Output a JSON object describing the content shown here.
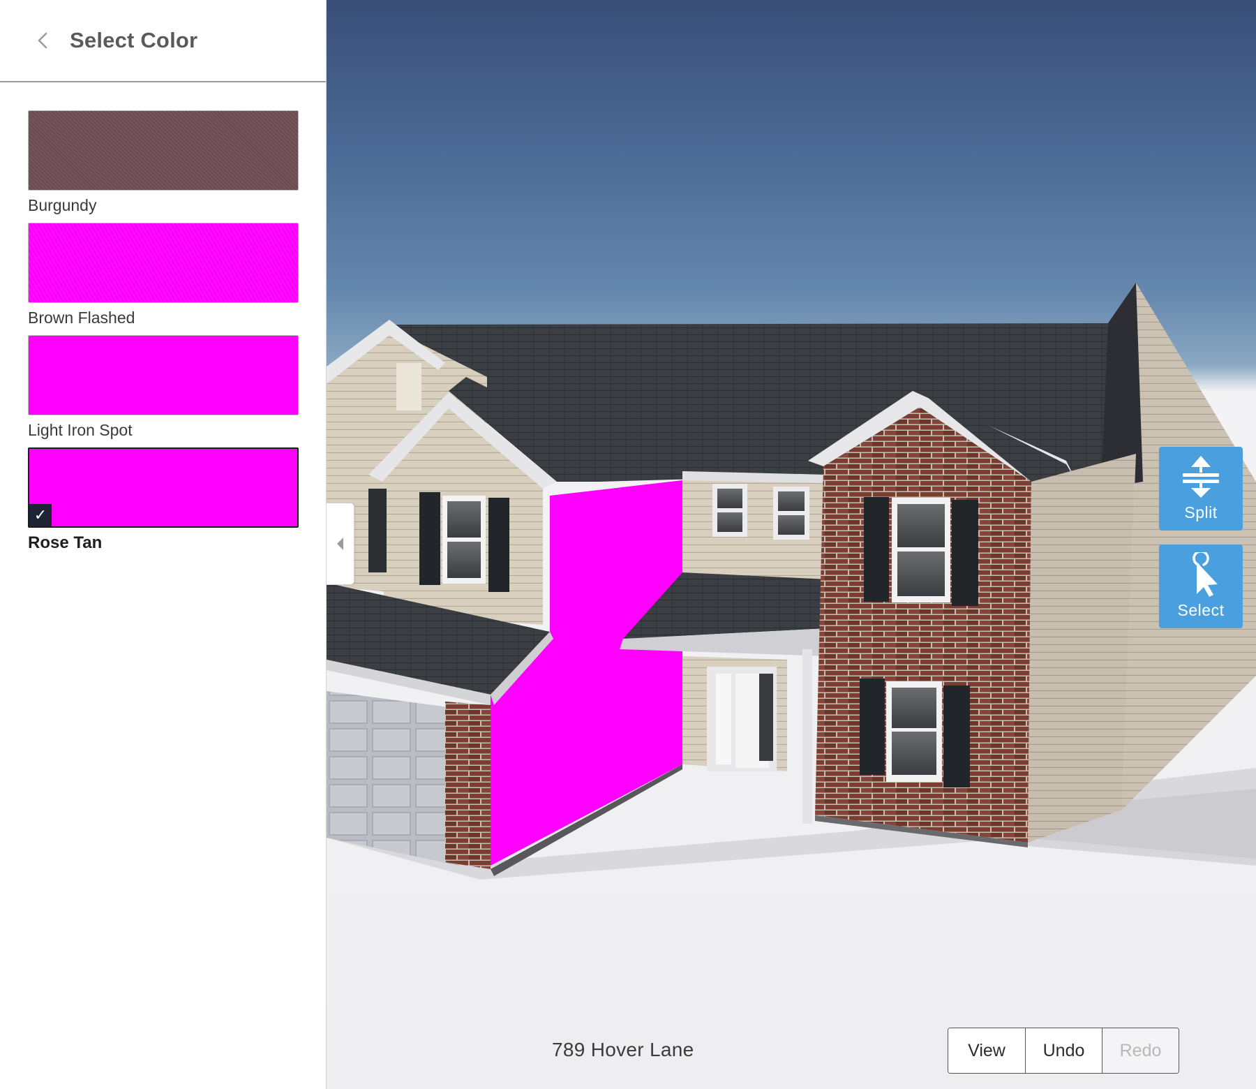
{
  "sidebar": {
    "title": "Select Color",
    "back_icon": "chevron-left-icon",
    "swatches": [
      {
        "label": "Burgundy",
        "color": "#6f4f55",
        "selected": false
      },
      {
        "label": "Brown Flashed",
        "color": "#ff00ff",
        "selected": false
      },
      {
        "label": "Light Iron Spot",
        "color": "#ff00ff",
        "selected": false
      },
      {
        "label": "Rose Tan",
        "color": "#ff00ff",
        "selected": true,
        "check_icon": "checkmark-icon",
        "check_glyph": "✓"
      }
    ]
  },
  "viewport": {
    "collapse_icon": "chevron-left-icon",
    "tools": {
      "split": {
        "label": "Split",
        "icon": "split-icon"
      },
      "select": {
        "label": "Select",
        "icon": "pointer-select-icon"
      }
    },
    "address": "789 Hover Lane",
    "actions": {
      "view": "View",
      "undo": "Undo",
      "redo": "Redo",
      "redo_disabled": true
    },
    "colors": {
      "accent_blue": "#4a9fde",
      "highlight_magenta": "#ff00ff",
      "roof": "#3a3d42",
      "siding": "#d9d1c2",
      "brick": "#7a3f33"
    }
  }
}
